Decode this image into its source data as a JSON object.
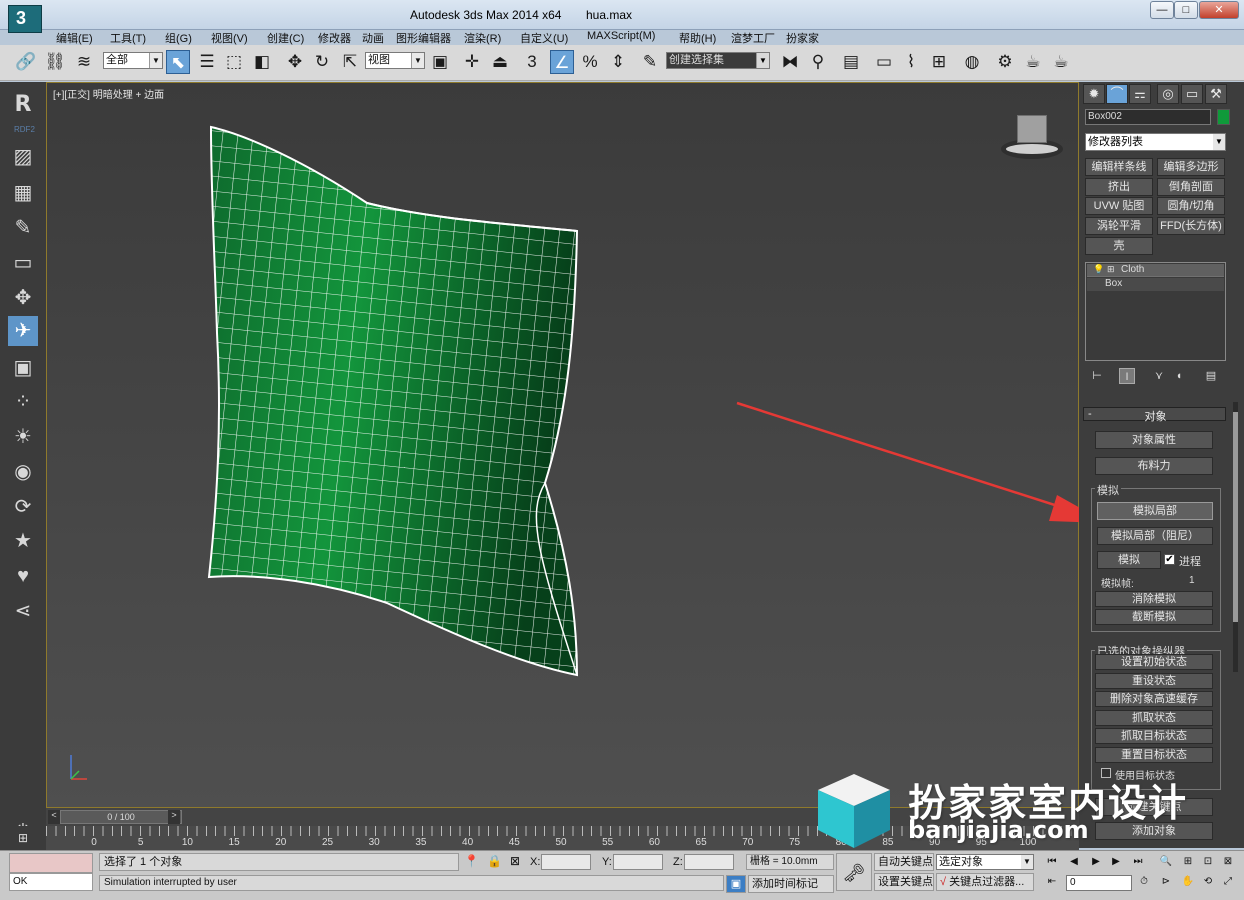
{
  "titlebar": {
    "app_title": "Autodesk 3ds Max  2014 x64",
    "file_name": "hua.max",
    "minimize": "—",
    "maximize": "□",
    "close": "✕"
  },
  "menubar": {
    "items": [
      "编辑(E)",
      "工具(T)",
      "组(G)",
      "视图(V)",
      "创建(C)",
      "修改器",
      "动画",
      "图形编辑器",
      "渲染(R)",
      "自定义(U)",
      "MAXScript(M)",
      "帮助(H)",
      "渲梦工厂",
      "扮家家"
    ]
  },
  "toolbar": {
    "filter_value": "全部",
    "refcoord_value": "视图",
    "snap_label": "3",
    "angle_snap_label": "%",
    "selset_value": "创建选择集"
  },
  "leftstrip": {
    "rdf_label": "RDF2"
  },
  "viewport": {
    "label_plus": "[+]",
    "label_view": "[正交]",
    "label_shading": "明暗处理 + 边面"
  },
  "timeslider": {
    "position": "0 / 100",
    "prev": "<",
    "next": ">"
  },
  "trackbar": {
    "ticks": [
      "0",
      "5",
      "10",
      "15",
      "20",
      "25",
      "30",
      "35",
      "40",
      "45",
      "50",
      "55",
      "60",
      "65",
      "70",
      "75",
      "80",
      "85",
      "90",
      "95",
      "100"
    ]
  },
  "cmdpanel": {
    "object_name": "Box002",
    "object_color": "#0f9a3a",
    "modifier_list": "修改器列表",
    "modifier_buttons": [
      "编辑样条线",
      "编辑多边形",
      "挤出",
      "倒角剖面",
      "UVW 贴图",
      "圆角/切角",
      "涡轮平滑",
      "FFD(长方体)",
      "壳"
    ],
    "stack": [
      "Cloth",
      "Box"
    ],
    "rollout_title": "对象",
    "rollout_minus": "-",
    "object_props": "对象属性",
    "cloth_forces": "布料力",
    "simulate_group": "模拟",
    "sim_local": "模拟局部",
    "sim_local_damped": "模拟局部（阻尼）",
    "simulate": "模拟",
    "progress_label": "进程",
    "progress_checked": "✔",
    "sim_frames_label": "模拟帧:",
    "sim_frames_value": "1",
    "erase_sim": "消除模拟",
    "truncate_sim": "截断模拟",
    "selected_group": "已选的对象操纵器",
    "set_initial": "设置初始状态",
    "reset_state": "重设状态",
    "delete_cache": "删除对象高速缓存",
    "grab_state": "抓取状态",
    "grab_target": "抓取目标状态",
    "reset_target": "重置目标状态",
    "use_target": "使用目标状态",
    "create_keys": "创建关键点",
    "add_objects": "添加对象"
  },
  "status": {
    "ok": "OK",
    "selection": "选择了 1 个对象",
    "prompt": "Simulation interrupted by user",
    "x_label": "X:",
    "y_label": "Y:",
    "z_label": "Z:",
    "grid": "栅格 = 10.0mm",
    "auto_key": "自动关键点",
    "set_key": "设置关键点",
    "selection_dd": "选定对象",
    "key_filters": "关键点过滤器...",
    "add_time_tag": "添加时间标记",
    "frame": "0"
  },
  "watermark": {
    "cn": "扮家家室内设计",
    "en": "banjiajia.com"
  },
  "colors": {
    "pillow_green": "#0d7d32",
    "viewport_bg": "#454545",
    "annotation_arrow": "#e53935"
  }
}
